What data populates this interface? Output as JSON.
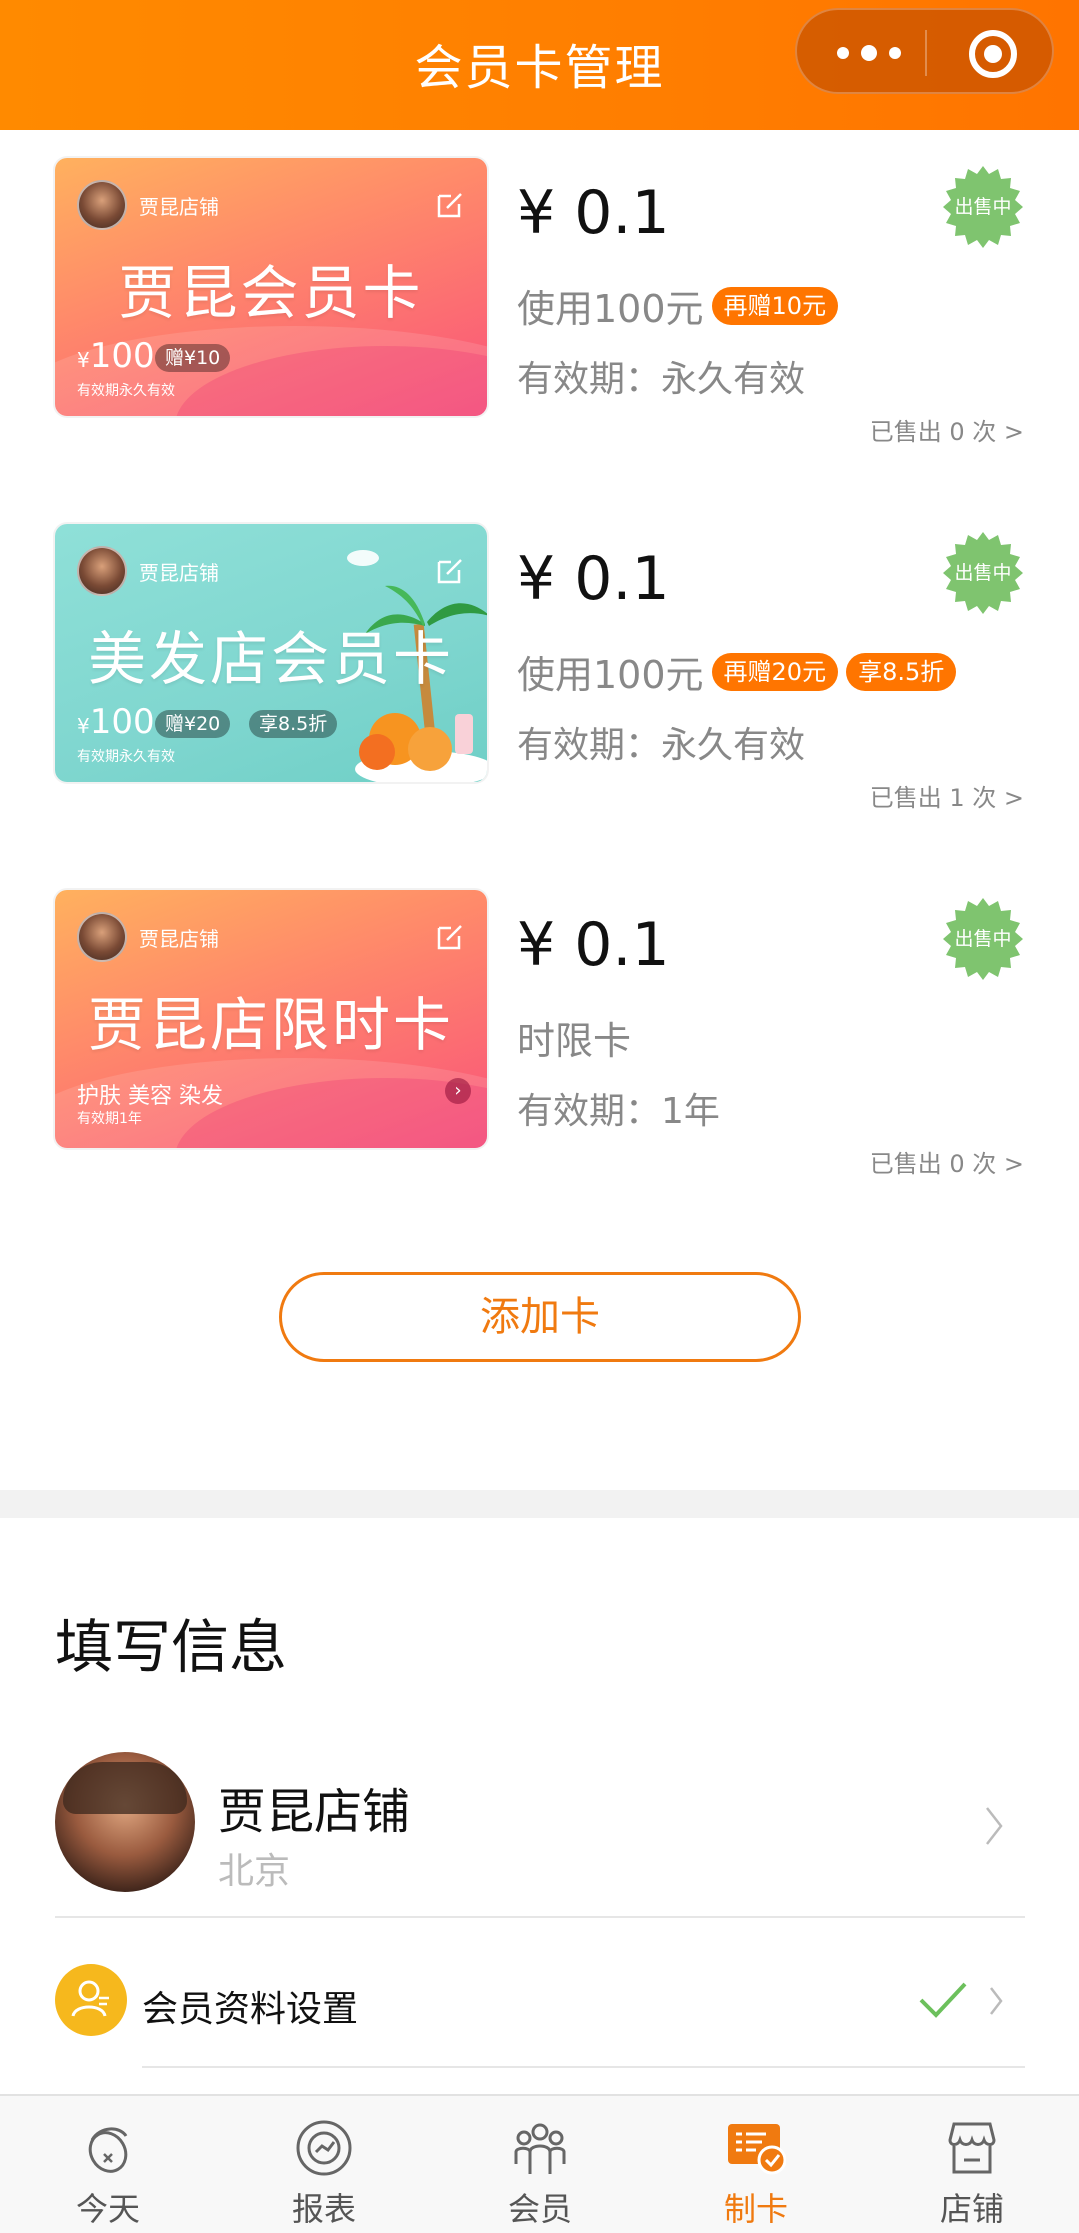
{
  "header": {
    "title": "会员卡管理"
  },
  "cards": [
    {
      "style": "pink",
      "shop_name": "贾昆店铺",
      "card_name": "贾昆会员卡",
      "amount": "100",
      "currency": "¥",
      "gift": "赠¥10",
      "validity": "有效期永久有效",
      "price": "¥ 0.1",
      "desc": "使用100元",
      "tags": [
        "再赠10元"
      ],
      "valid_text": "有效期：永久有效",
      "sold_text": "已售出 0 次 >",
      "status": "出售中"
    },
    {
      "style": "teal",
      "shop_name": "贾昆店铺",
      "card_name": "美发店会员卡",
      "amount": "100",
      "currency": "¥",
      "gift": "赠¥20",
      "discount": "享8.5折",
      "validity": "有效期永久有效",
      "price": "¥ 0.1",
      "desc": "使用100元",
      "tags": [
        "再赠20元",
        "享8.5折"
      ],
      "valid_text": "有效期：永久有效",
      "sold_text": "已售出 1 次 >",
      "status": "出售中"
    },
    {
      "style": "pink",
      "shop_name": "贾昆店铺",
      "card_name": "贾昆店限时卡",
      "services": "护肤 美容 染发",
      "validity": "有效期1年",
      "price": "¥ 0.1",
      "desc": "时限卡",
      "tags": [],
      "valid_text": "有效期：1年",
      "sold_text": "已售出 0 次 >",
      "status": "出售中"
    }
  ],
  "add_button": "添加卡",
  "info": {
    "title": "填写信息",
    "shop_name": "贾昆店铺",
    "shop_city": "北京",
    "member_settings": "会员资料设置"
  },
  "tabs": [
    {
      "label": "今天",
      "icon": "acorn-icon",
      "active": false
    },
    {
      "label": "报表",
      "icon": "report-icon",
      "active": false
    },
    {
      "label": "会员",
      "icon": "members-icon",
      "active": false
    },
    {
      "label": "制卡",
      "icon": "make-card-icon",
      "active": true
    },
    {
      "label": "店铺",
      "icon": "store-icon",
      "active": false
    }
  ],
  "colors": {
    "accent": "#ff7a00",
    "badge_green": "#7fc46f",
    "tag_orange": "#ff7500"
  }
}
